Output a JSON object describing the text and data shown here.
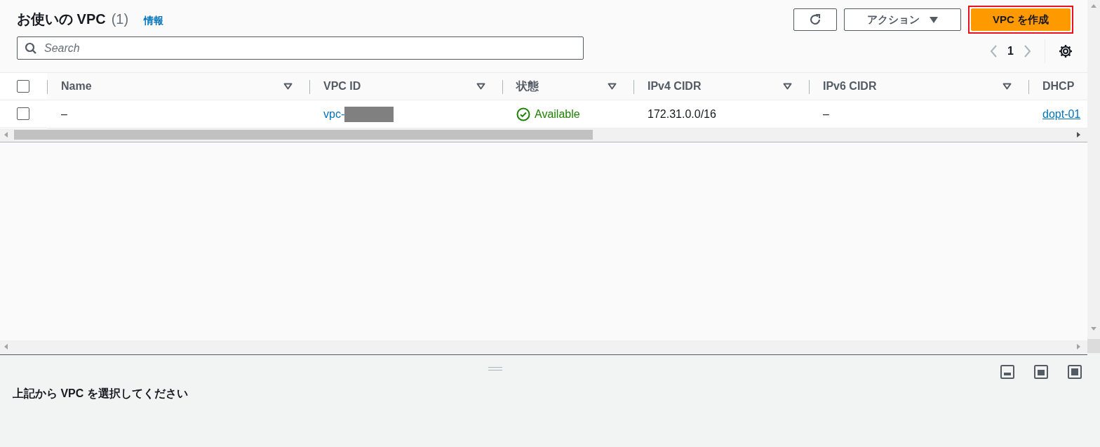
{
  "header": {
    "title": "お使いの VPC",
    "count": "(1)",
    "info_link": "情報"
  },
  "buttons": {
    "refresh": {
      "kind": "refresh"
    },
    "actions": {
      "label": "アクション"
    },
    "create": {
      "label": "VPC を作成",
      "highlighted": true
    }
  },
  "search": {
    "placeholder": "Search"
  },
  "pagination": {
    "page": "1"
  },
  "table": {
    "columns": [
      {
        "label": "Name",
        "filter": true
      },
      {
        "label": "VPC ID",
        "filter": true
      },
      {
        "label": "状態",
        "filter": true
      },
      {
        "label": "IPv4 CIDR",
        "filter": true
      },
      {
        "label": "IPv6 CIDR",
        "filter": true
      },
      {
        "label": "DHCP",
        "filter": false
      }
    ],
    "select_all": {
      "checked": false
    },
    "rows": [
      {
        "checked": false,
        "cells": [
          {
            "kind": "text",
            "text": "–"
          },
          {
            "kind": "redacted-link",
            "text": "vpc-"
          },
          {
            "kind": "status",
            "text": "Available"
          },
          {
            "kind": "text",
            "text": "172.31.0.0/16"
          },
          {
            "kind": "text",
            "text": "–"
          },
          {
            "kind": "underlined-link",
            "text": "dopt-01"
          }
        ]
      }
    ]
  },
  "split_panel": {
    "message": "上記から VPC を選択してください"
  }
}
